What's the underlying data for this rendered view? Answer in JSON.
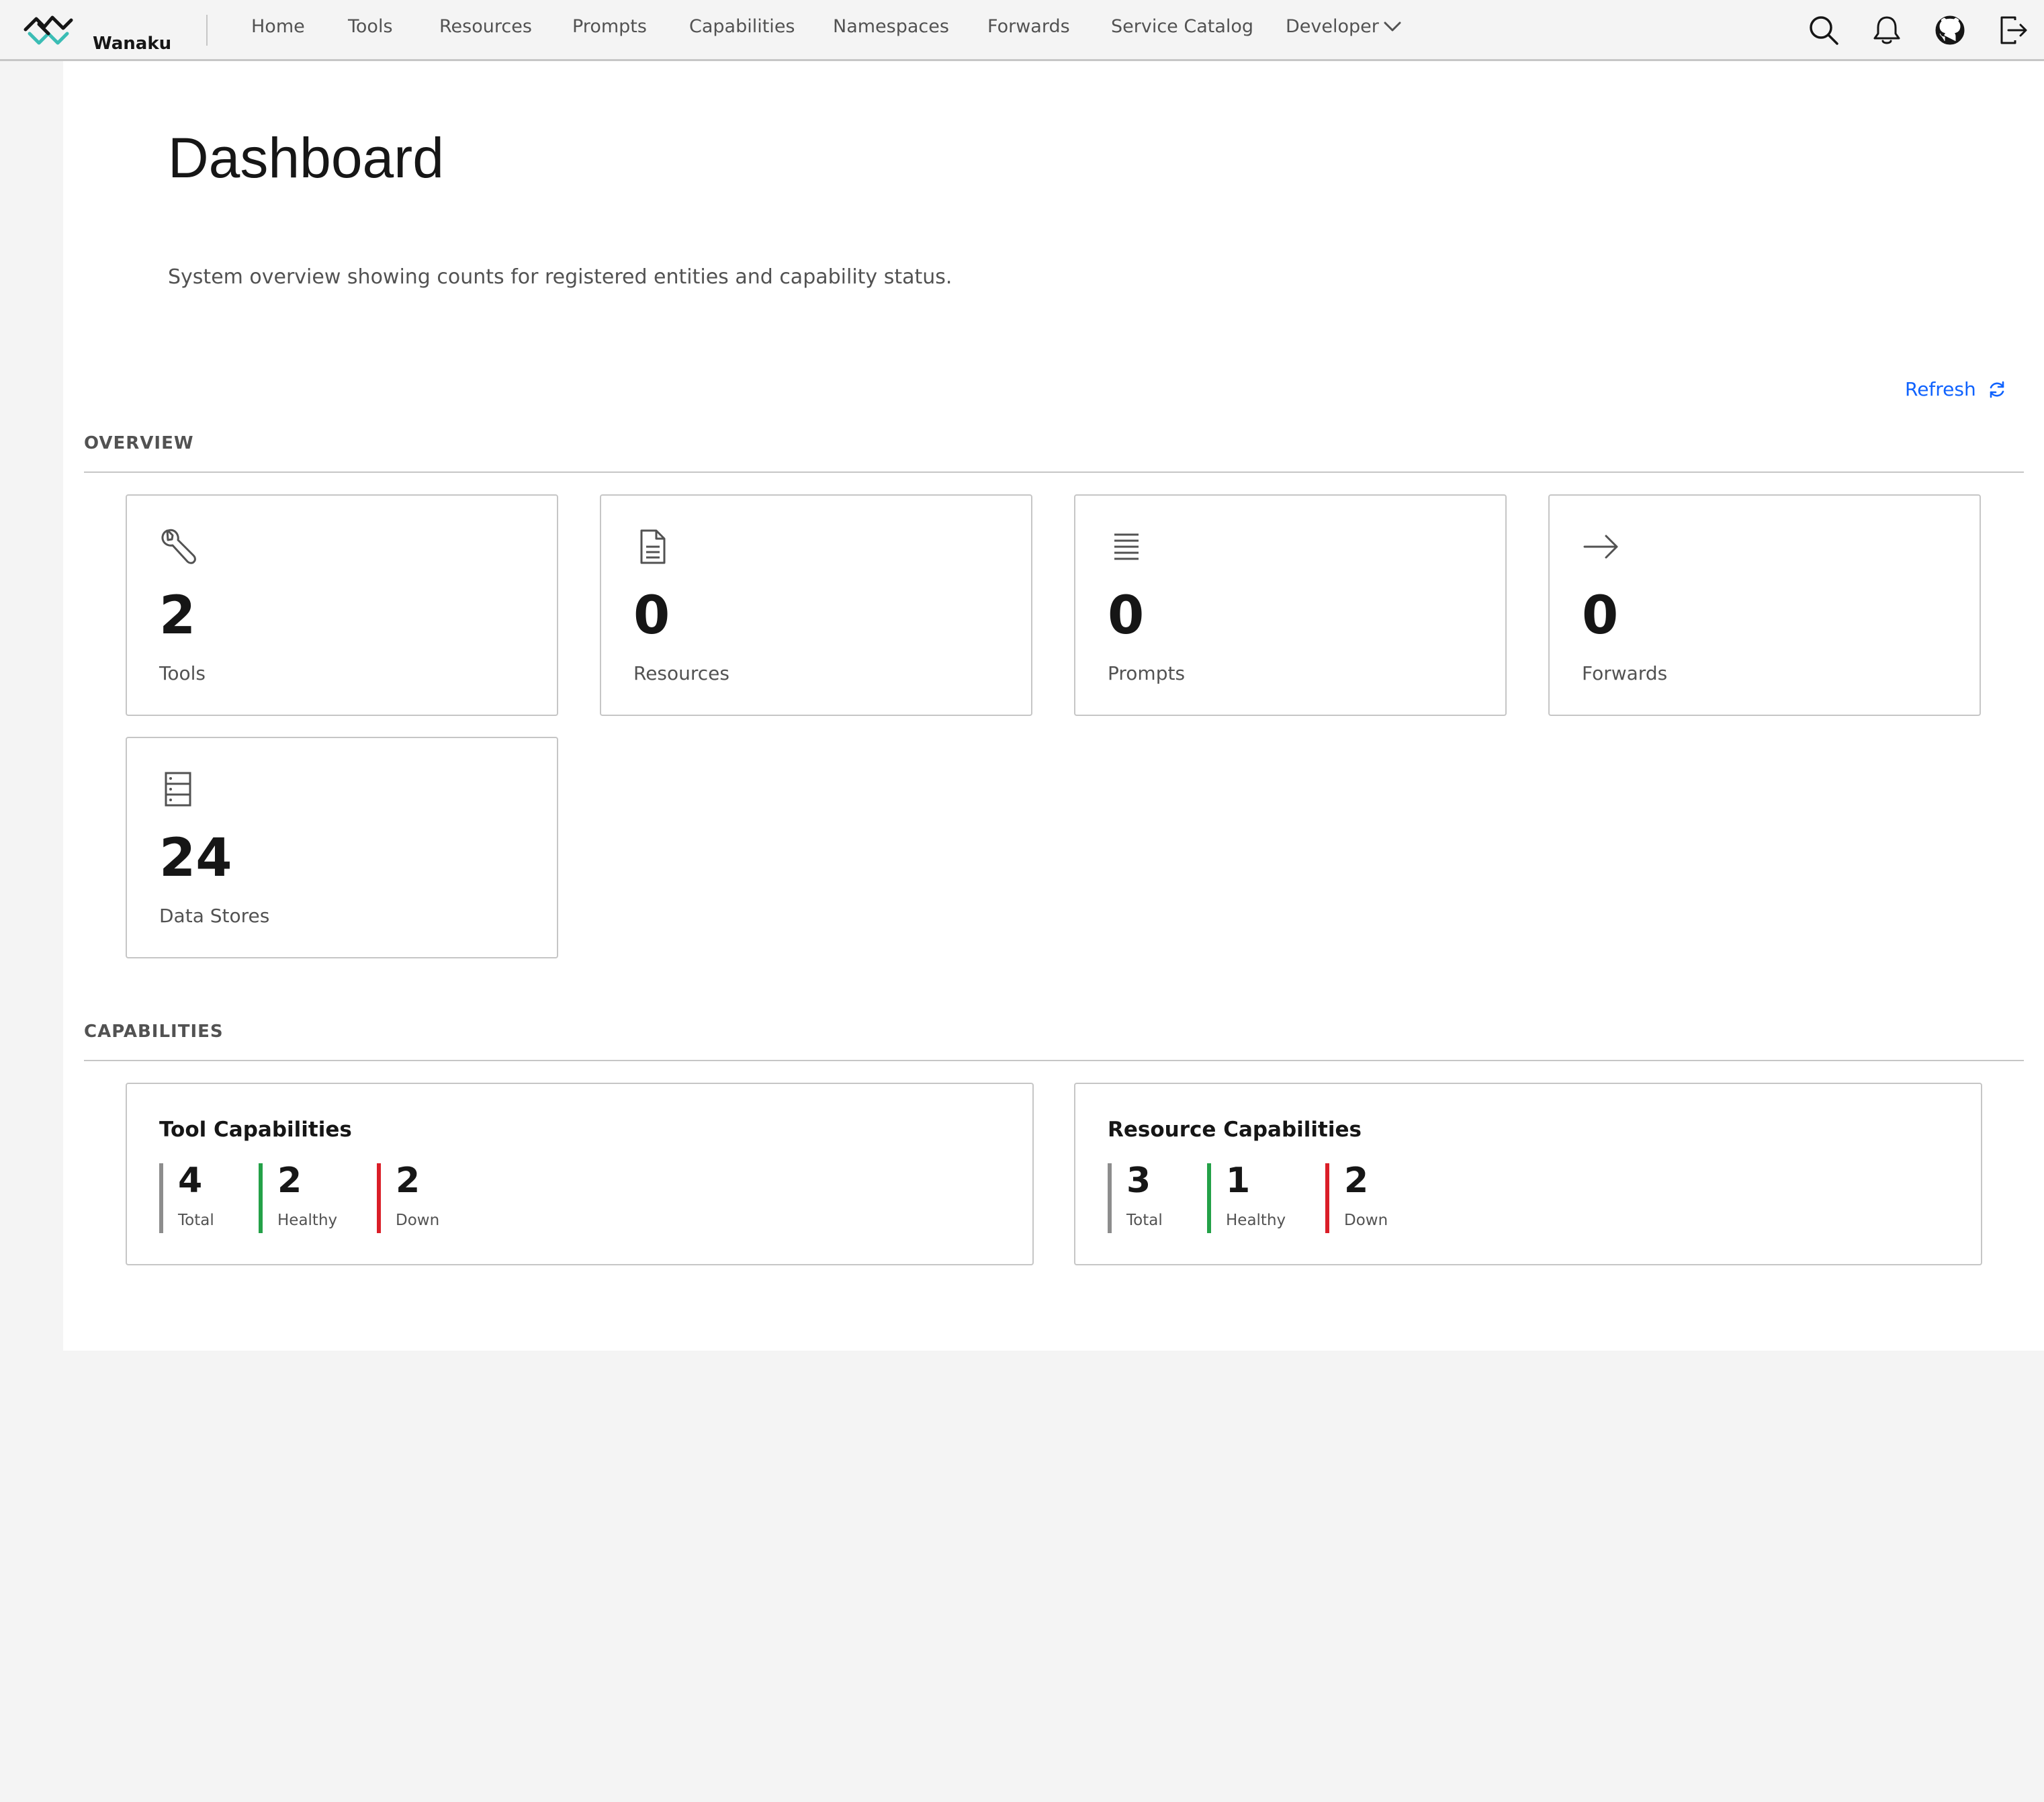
{
  "brand": {
    "name": "Wanaku",
    "accent_color": "#3bbdb5"
  },
  "nav": {
    "items": [
      {
        "label": "Home"
      },
      {
        "label": "Tools"
      },
      {
        "label": "Resources"
      },
      {
        "label": "Prompts"
      },
      {
        "label": "Capabilities"
      },
      {
        "label": "Namespaces"
      },
      {
        "label": "Forwards"
      },
      {
        "label": "Service Catalog"
      },
      {
        "label": "Developer"
      }
    ],
    "dropdown_icon": "chevron-down-icon"
  },
  "header_actions": [
    {
      "icon": "search-icon"
    },
    {
      "icon": "bell-icon"
    },
    {
      "icon": "github-icon"
    },
    {
      "icon": "logout-icon"
    }
  ],
  "page": {
    "title": "Dashboard",
    "description": "System overview showing counts for registered entities and capability status.",
    "refresh_label": "Refresh",
    "refresh_color": "#0f62fe"
  },
  "overview": {
    "title": "OVERVIEW",
    "cards": [
      {
        "icon": "wrench-icon",
        "value": "2",
        "label": "Tools"
      },
      {
        "icon": "document-icon",
        "value": "0",
        "label": "Resources"
      },
      {
        "icon": "list-icon",
        "value": "0",
        "label": "Prompts"
      },
      {
        "icon": "arrow-right-icon",
        "value": "0",
        "label": "Forwards"
      },
      {
        "icon": "data-store-icon",
        "value": "24",
        "label": "Data Stores"
      }
    ]
  },
  "capabilities": {
    "title": "CAPABILITIES",
    "status_colors": {
      "total": "#8d8d8d",
      "healthy": "#24a148",
      "down": "#da1e28"
    },
    "cards": [
      {
        "title": "Tool Capabilities",
        "stats": [
          {
            "value": "4",
            "label": "Total"
          },
          {
            "value": "2",
            "label": "Healthy"
          },
          {
            "value": "2",
            "label": "Down"
          }
        ]
      },
      {
        "title": "Resource Capabilities",
        "stats": [
          {
            "value": "3",
            "label": "Total"
          },
          {
            "value": "1",
            "label": "Healthy"
          },
          {
            "value": "2",
            "label": "Down"
          }
        ]
      }
    ]
  }
}
